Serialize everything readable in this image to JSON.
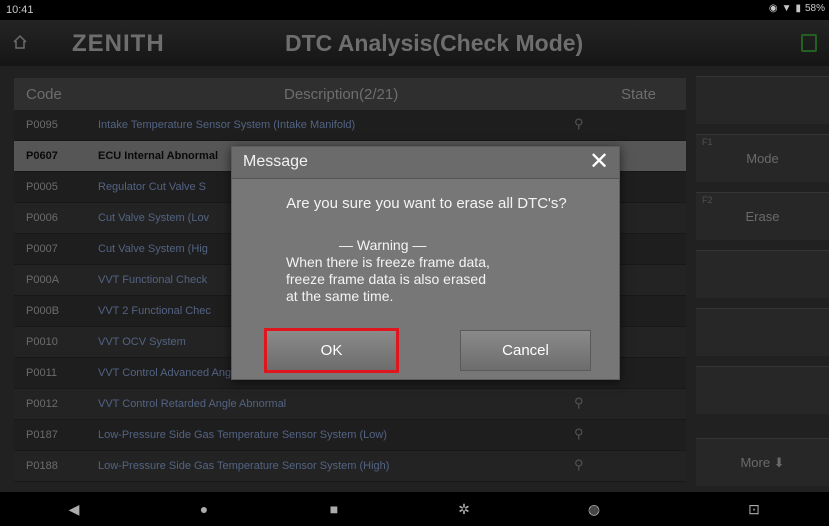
{
  "status": {
    "time": "10:41",
    "battery": "58%"
  },
  "header": {
    "logo": "ZENITH",
    "title": "DTC Analysis(Check Mode)"
  },
  "table": {
    "col_code": "Code",
    "col_desc": "Description(2/21)",
    "col_state": "State",
    "rows": [
      {
        "code": "P0095",
        "desc": "Intake Temperature Sensor System (Intake Manifold)"
      },
      {
        "code": "P0607",
        "desc": "ECU Internal Abnormal"
      },
      {
        "code": "P0005",
        "desc": "Regulator Cut Valve S"
      },
      {
        "code": "P0006",
        "desc": "Cut Valve System (Lov"
      },
      {
        "code": "P0007",
        "desc": "Cut Valve System (Hig"
      },
      {
        "code": "P000A",
        "desc": "VVT Functional Check"
      },
      {
        "code": "P000B",
        "desc": "VVT 2 Functional Chec"
      },
      {
        "code": "P0010",
        "desc": "VVT OCV System"
      },
      {
        "code": "P0011",
        "desc": "VVT Control Advanced Angle Abnormal"
      },
      {
        "code": "P0012",
        "desc": "VVT Control Retarded Angle Abnormal"
      },
      {
        "code": "P0187",
        "desc": "Low-Pressure Side Gas Temperature Sensor System (Low)"
      },
      {
        "code": "P0188",
        "desc": "Low-Pressure Side Gas Temperature Sensor System (High)"
      }
    ]
  },
  "side": {
    "mode_num": "F1",
    "mode": "Mode",
    "erase_num": "F2",
    "erase": "Erase",
    "more": "More ⬇"
  },
  "dialog": {
    "title": "Message",
    "close": "✕",
    "question": "Are you sure you want to erase all DTC's?",
    "warning_title": "— Warning —",
    "warning_line1": "When there is freeze frame data,",
    "warning_line2": "freeze frame data is also erased",
    "warning_line3": "at the same time.",
    "ok": "OK",
    "cancel": "Cancel"
  },
  "icons": {
    "home": "home-icon",
    "search": "search-icon",
    "back": "back-icon",
    "navhome": "home-circle-icon",
    "recent": "recent-apps-icon",
    "settings": "gear-icon",
    "app": "app-icon",
    "screenshot": "screenshot-icon"
  },
  "colors": {
    "highlight": "#e0161e",
    "accent": "#2e7d2e"
  }
}
